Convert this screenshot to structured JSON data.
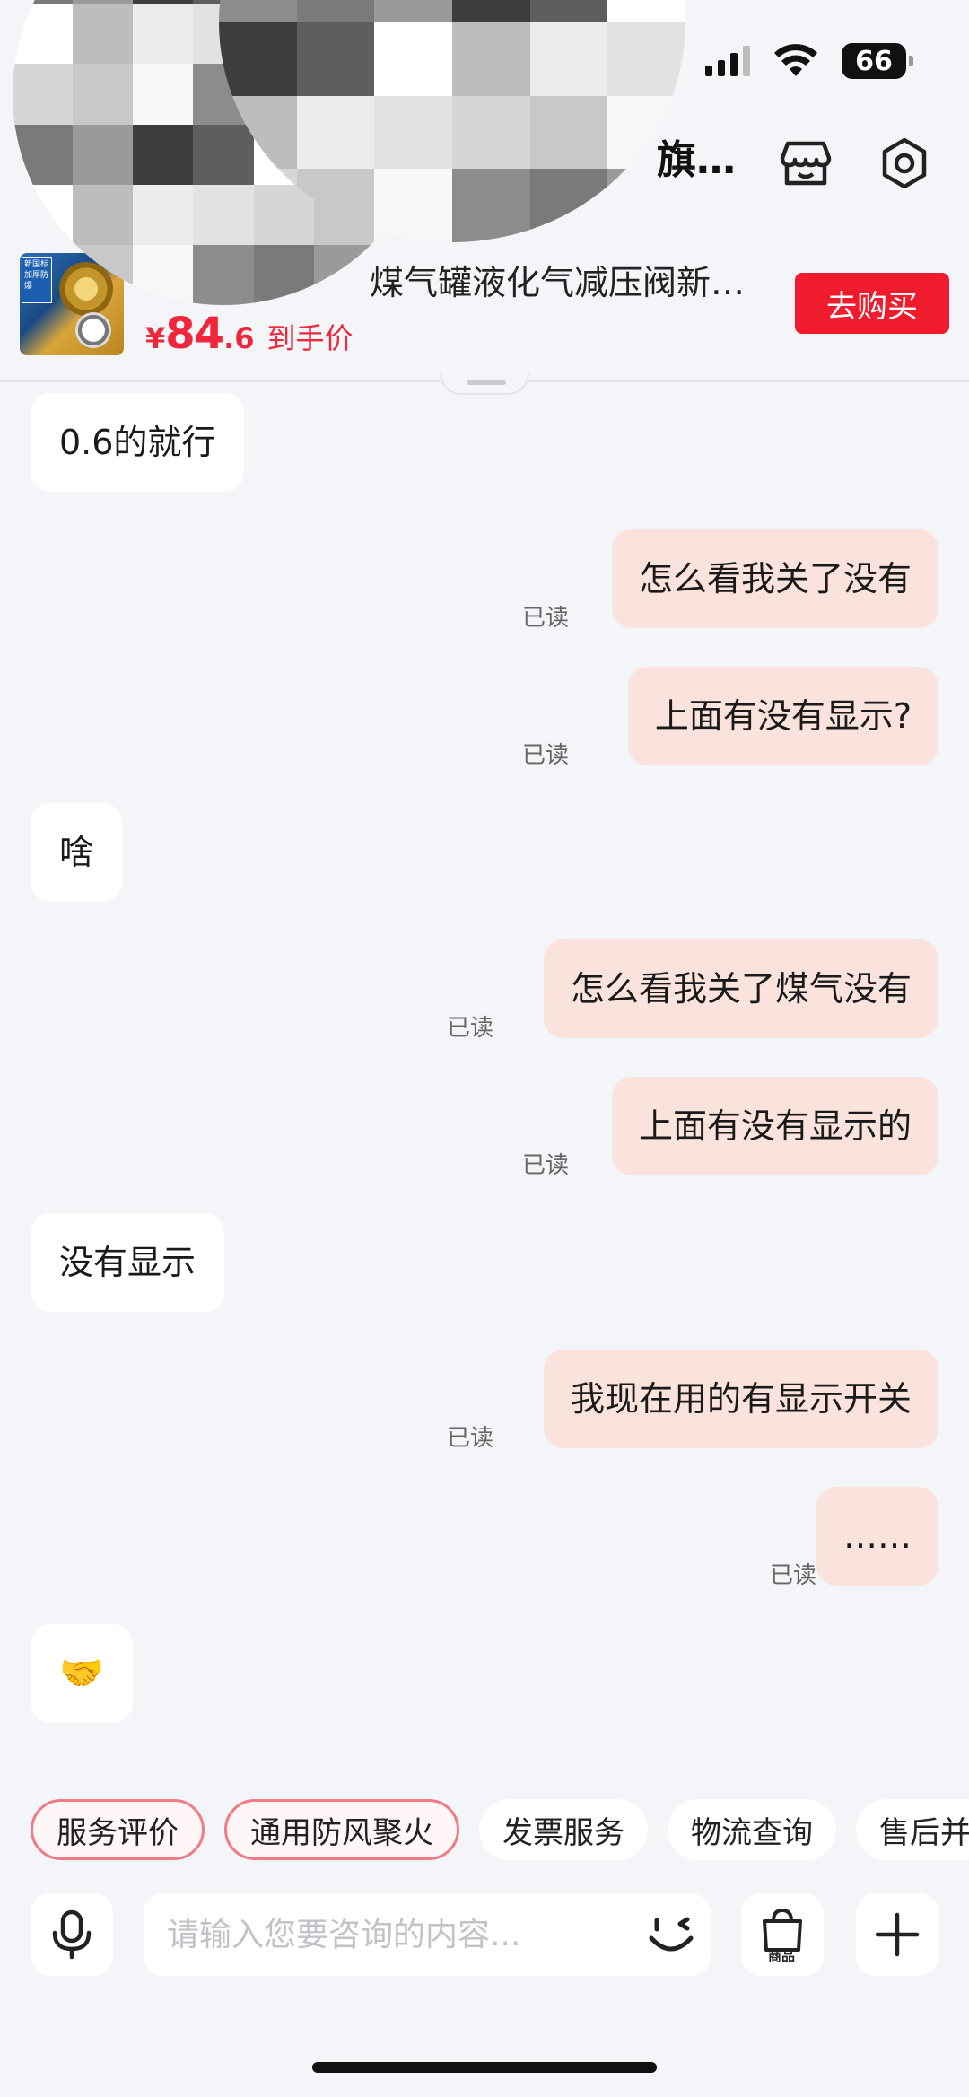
{
  "status_bar": {
    "battery": "66"
  },
  "header": {
    "shop_title": "旗…"
  },
  "product": {
    "name": "煤气罐液化气减压阀新…",
    "thumb_tag": "新国标 加厚防爆",
    "price_symbol": "¥",
    "price_integer": "84",
    "price_decimal": ".6",
    "price_suffix": "到手价",
    "buy_label": "去购买"
  },
  "messages": [
    {
      "side": "in",
      "text": "0.6的就行",
      "read": ""
    },
    {
      "side": "out",
      "text": "怎么看我关了没有",
      "read": "已读"
    },
    {
      "side": "out",
      "text": "上面有没有显示?",
      "read": "已读"
    },
    {
      "side": "in",
      "text": "啥",
      "read": ""
    },
    {
      "side": "out",
      "text": "怎么看我关了煤气没有",
      "read": "已读"
    },
    {
      "side": "out",
      "text": "上面有没有显示的",
      "read": "已读"
    },
    {
      "side": "in",
      "text": " 没有显示 ",
      "read": ""
    },
    {
      "side": "out",
      "text": "我现在用的有显示开关",
      "read": "已读"
    },
    {
      "side": "out",
      "text": "……",
      "read": "已读"
    },
    {
      "side": "in",
      "text": "🤝",
      "read": ""
    }
  ],
  "quick_replies": [
    "服务评价",
    "通用防风聚火",
    "发票服务",
    "物流查询",
    "售后并"
  ],
  "input": {
    "placeholder": "请输入您要咨询的内容...",
    "goods_label": "商品"
  },
  "colors": {
    "accent_red": "#f01b2c",
    "price_red": "#f0263a",
    "out_bubble": "#fae3dc",
    "background": "#f4f5f9"
  }
}
